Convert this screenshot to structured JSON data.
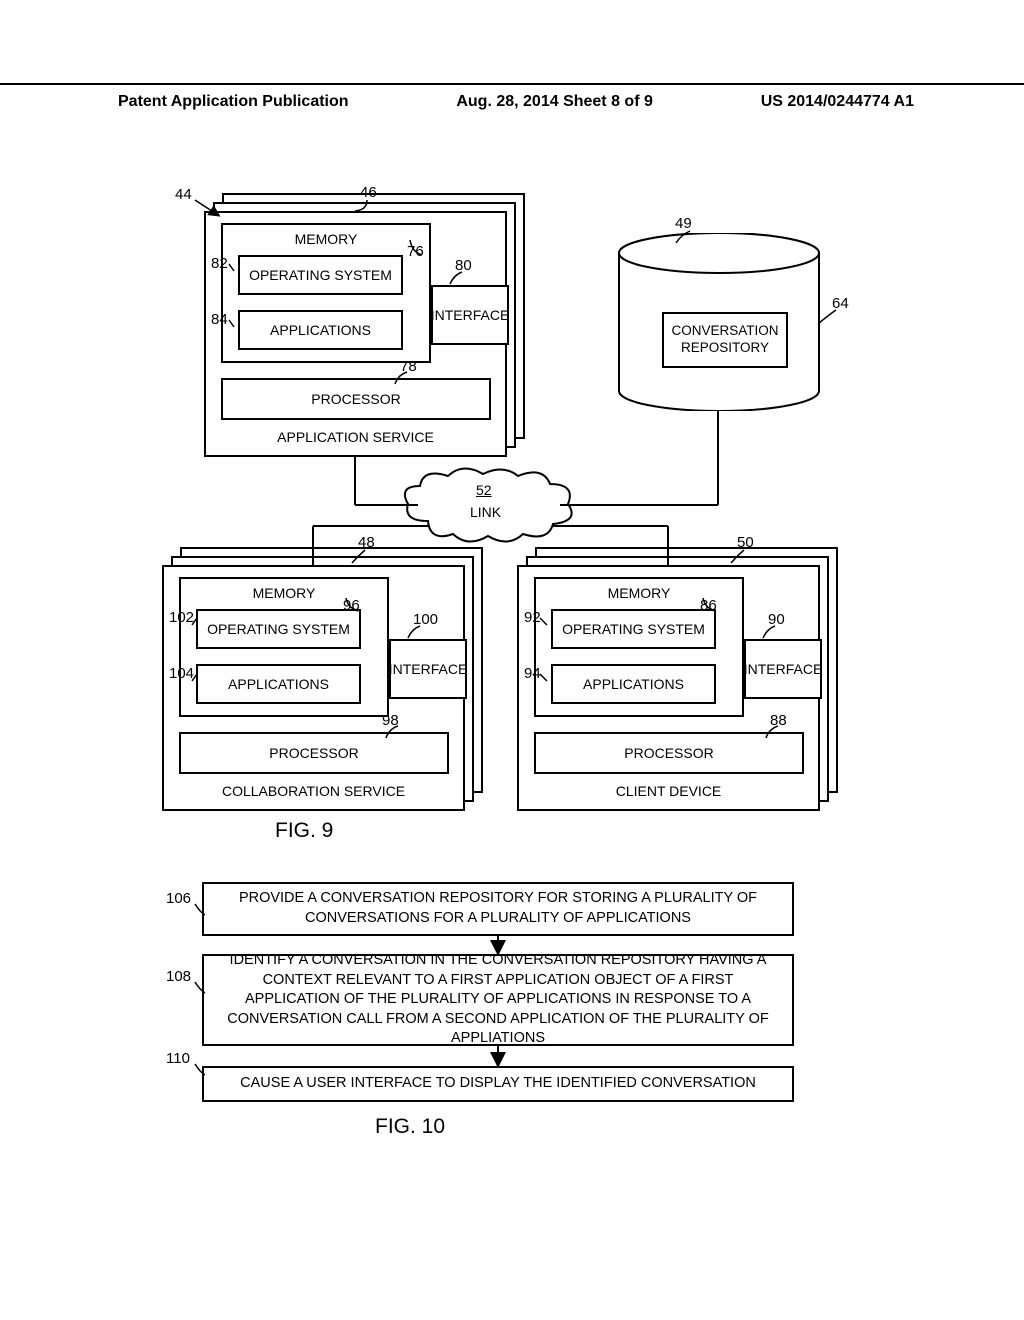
{
  "header": {
    "left": "Patent Application Publication",
    "center": "Aug. 28, 2014  Sheet 8 of 9",
    "right": "US 2014/0244774 A1"
  },
  "fig9": {
    "title": "FIG. 9",
    "appService": {
      "title": "APPLICATION SERVICE",
      "memory": "MEMORY",
      "os": "OPERATING SYSTEM",
      "apps": "APPLICATIONS",
      "interface": "INTERFACE",
      "processor": "PROCESSOR",
      "ref": "44",
      "ref_svc": "46",
      "ref_mem": "76",
      "ref_os": "82",
      "ref_apps": "84",
      "ref_if": "80",
      "ref_proc": "78"
    },
    "repo": {
      "label": "CONVERSATION REPOSITORY",
      "ref": "49",
      "ref_inner": "64"
    },
    "link": {
      "label": "LINK",
      "ref": "52"
    },
    "collab": {
      "title": "COLLABORATION SERVICE",
      "memory": "MEMORY",
      "os": "OPERATING SYSTEM",
      "apps": "APPLICATIONS",
      "interface": "INTERFACE",
      "processor": "PROCESSOR",
      "ref": "48",
      "ref_mem": "96",
      "ref_os": "102",
      "ref_apps": "104",
      "ref_if": "100",
      "ref_proc": "98"
    },
    "client": {
      "title": "CLIENT DEVICE",
      "memory": "MEMORY",
      "os": "OPERATING SYSTEM",
      "apps": "APPLICATIONS",
      "interface": "INTERFACE",
      "processor": "PROCESSOR",
      "ref": "50",
      "ref_mem": "86",
      "ref_os": "92",
      "ref_apps": "94",
      "ref_if": "90",
      "ref_proc": "88"
    }
  },
  "fig10": {
    "title": "FIG. 10",
    "step1": {
      "ref": "106",
      "text": "PROVIDE A CONVERSATION REPOSITORY FOR STORING A PLURALITY OF CONVERSATIONS FOR A PLURALITY OF APPLICATIONS"
    },
    "step2": {
      "ref": "108",
      "text": "IDENTIFY A CONVERSATION IN THE CONVERSATION REPOSITORY HAVING A CONTEXT RELEVANT TO A FIRST APPLICATION OBJECT OF A FIRST APPLICATION OF THE PLURALITY OF APPLICATIONS IN RESPONSE TO A CONVERSATION CALL FROM A SECOND APPLICATION OF THE PLURALITY OF APPLIATIONS"
    },
    "step3": {
      "ref": "110",
      "text": "CAUSE A USER INTERFACE TO DISPLAY THE IDENTIFIED CONVERSATION"
    }
  }
}
